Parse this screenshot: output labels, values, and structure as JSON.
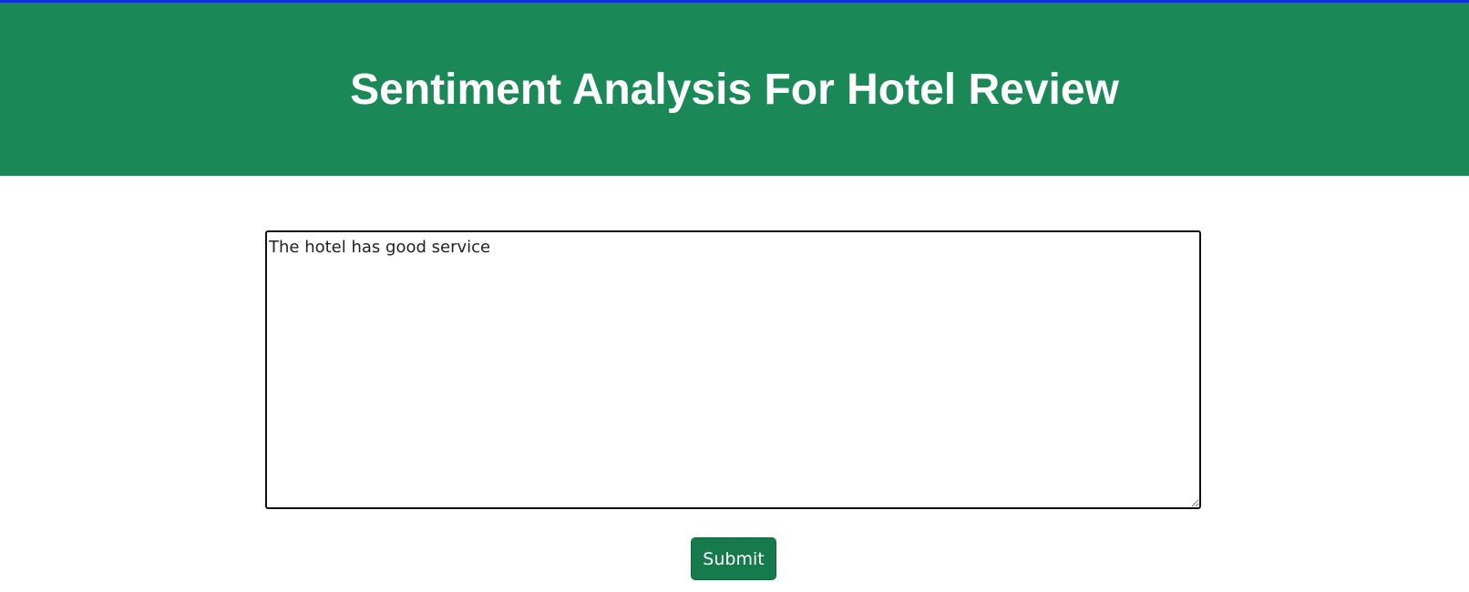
{
  "header": {
    "title": "Sentiment Analysis For Hotel Review"
  },
  "review_form": {
    "input_value": "The hotel has good service ",
    "submit_label": "Submit"
  },
  "colors": {
    "header_bg": "#1b8957",
    "top_accent": "#0a2fd6",
    "button_bg": "#177a4d",
    "title_text": "#ffffff"
  }
}
